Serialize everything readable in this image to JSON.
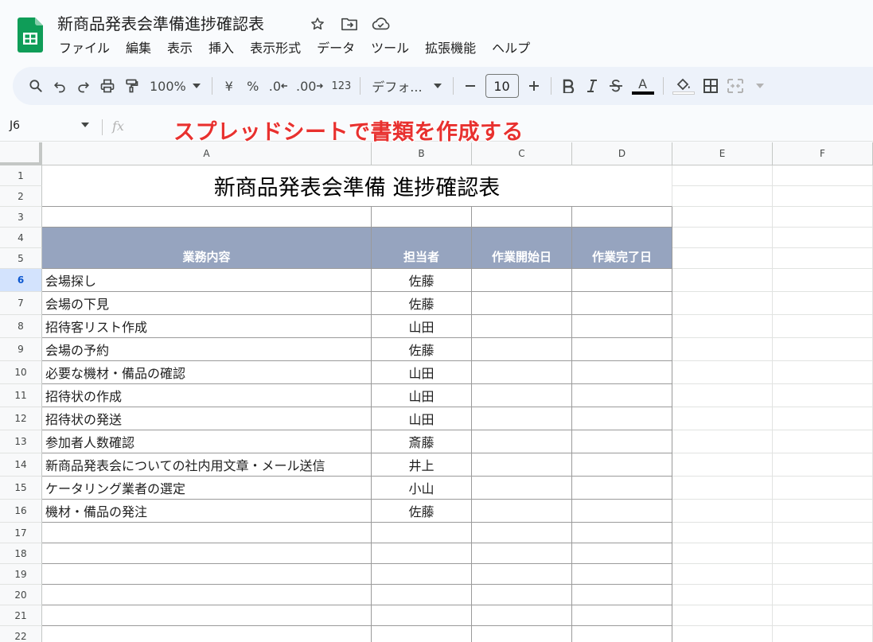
{
  "document": {
    "title": "新商品発表会準備進捗確認表"
  },
  "menu": [
    "ファイル",
    "編集",
    "表示",
    "挿入",
    "表示形式",
    "データ",
    "ツール",
    "拡張機能",
    "ヘルプ"
  ],
  "toolbar": {
    "zoom": "100%",
    "currency": "¥",
    "percent": "%",
    "dec_decrease": ".0",
    "dec_increase": ".00",
    "more_formats": "123",
    "font": "デフォ...",
    "font_size": "10",
    "text_color_letter": "A",
    "text_color": "#000000",
    "fill_color": "#ffffff"
  },
  "formula_bar": {
    "cell_ref": "J6",
    "fx": "fx",
    "value": ""
  },
  "overlay_caption": "スプレッドシートで書類を作成する",
  "columns": [
    "A",
    "B",
    "C",
    "D",
    "E",
    "F"
  ],
  "rows": [
    "1",
    "2",
    "3",
    "4",
    "5",
    "6",
    "7",
    "8",
    "9",
    "10",
    "11",
    "12",
    "13",
    "14",
    "15",
    "16",
    "17",
    "18",
    "19",
    "20",
    "21",
    "22"
  ],
  "active_row": "6",
  "sheet": {
    "title": "新商品発表会準備 進捗確認表",
    "headers": [
      "業務内容",
      "担当者",
      "作業開始日",
      "作業完了日"
    ],
    "header_color": "#96a4bf",
    "tasks": [
      {
        "task": "会場探し",
        "owner": "佐藤"
      },
      {
        "task": "会場の下見",
        "owner": "佐藤"
      },
      {
        "task": "招待客リスト作成",
        "owner": "山田"
      },
      {
        "task": "会場の予約",
        "owner": "佐藤"
      },
      {
        "task": "必要な機材・備品の確認",
        "owner": "山田"
      },
      {
        "task": "招待状の作成",
        "owner": "山田"
      },
      {
        "task": "招待状の発送",
        "owner": "山田"
      },
      {
        "task": "参加者人数確認",
        "owner": "斎藤"
      },
      {
        "task": "新商品発表会についての社内用文章・メール送信",
        "owner": "井上"
      },
      {
        "task": "ケータリング業者の選定",
        "owner": "小山"
      },
      {
        "task": "機材・備品の発注",
        "owner": "佐藤"
      }
    ]
  },
  "colors": {
    "accent": "#0b57d0",
    "caption": "#e8312f",
    "sheets_green": "#0f9d58"
  }
}
